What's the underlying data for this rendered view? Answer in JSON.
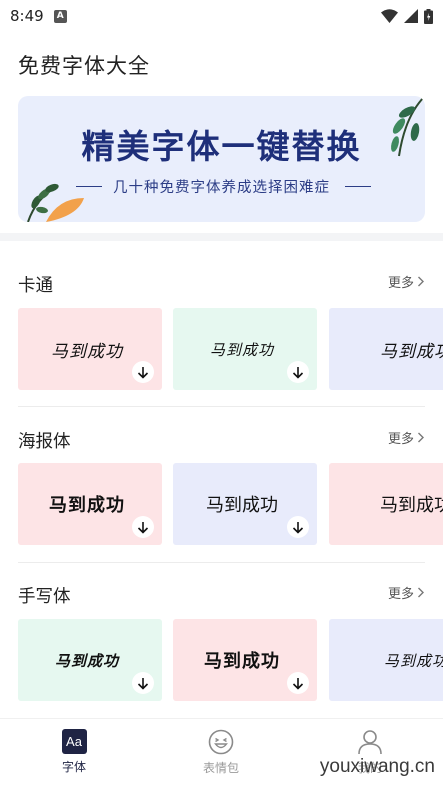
{
  "status_bar": {
    "time": "8:49",
    "notification_icon": "A"
  },
  "app": {
    "title": "免费字体大全"
  },
  "banner": {
    "title": "精美字体一键替换",
    "subtitle": "几十种免费字体养成选择困难症"
  },
  "sections": [
    {
      "title": "卡通",
      "more": "更多",
      "cards": [
        "马到成功",
        "马到成功",
        "马到成功"
      ]
    },
    {
      "title": "海报体",
      "more": "更多",
      "cards": [
        "马到成功",
        "马到成功",
        "马到成功"
      ]
    },
    {
      "title": "手写体",
      "more": "更多",
      "cards": [
        "马到成功",
        "马到成功",
        "马到成功"
      ]
    }
  ],
  "tabbar": {
    "tabs": [
      {
        "label": "字体",
        "icon_text": "Aa"
      },
      {
        "label": "表情包"
      },
      {
        "label": "我的"
      }
    ]
  },
  "colors": {
    "active_tab": "#1f2444",
    "inactive_tab": "#9a9a9a",
    "banner_bg": "#e9eefc",
    "banner_title": "#1e2f7a"
  },
  "watermark": "youxiwang.cn"
}
